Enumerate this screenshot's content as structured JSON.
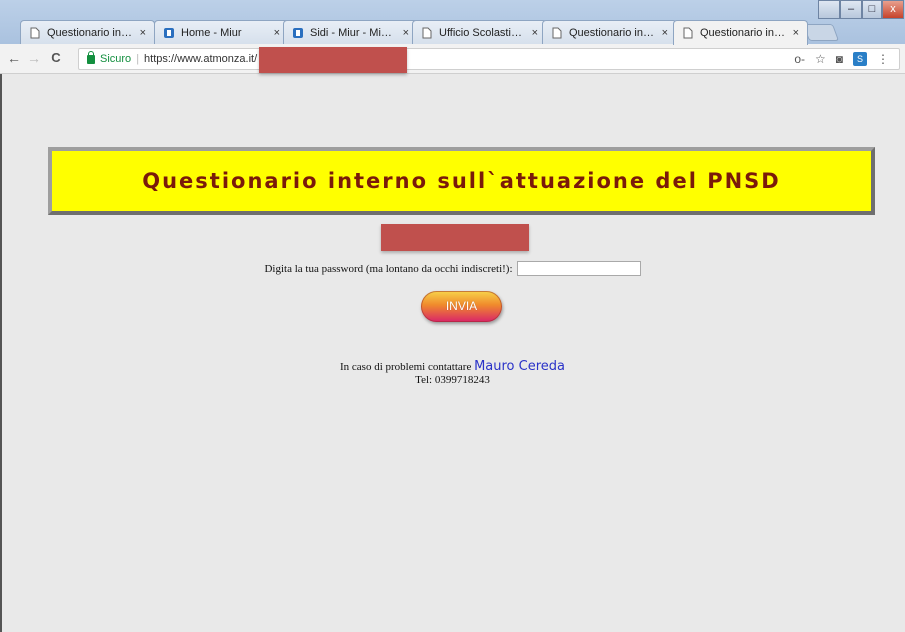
{
  "browser": {
    "tabs": [
      {
        "title": "Questionario interno s",
        "icon": "page-icon",
        "active": false
      },
      {
        "title": "Home - Miur",
        "icon": "miur-icon",
        "active": false
      },
      {
        "title": "Sidi - Miur - Ministero",
        "icon": "miur-icon",
        "active": false
      },
      {
        "title": "Ufficio Scolastico Terri",
        "icon": "page-icon",
        "active": false
      },
      {
        "title": "Questionario interno s",
        "icon": "page-icon",
        "active": false
      },
      {
        "title": "Questionario interno s",
        "icon": "page-icon",
        "active": true
      }
    ],
    "tab_close": "×",
    "window_controls": {
      "minimize": "–",
      "maximize": "□",
      "close": "x"
    },
    "nav": {
      "back": "←",
      "forward": "→",
      "reload": "C"
    },
    "address": {
      "secure_label": "Sicuro",
      "separator": "|",
      "url": "https://www.atmonza.it/"
    },
    "omni_icons": {
      "key": "o-",
      "star": "☆",
      "camera": "◙",
      "extension": "S"
    }
  },
  "page": {
    "title": "Questionario interno sull`attuazione del PNSD",
    "password_label": "Digita la tua password (ma lontano da occhi indiscreti!):",
    "password_value": "",
    "submit_label": "INVIA",
    "contact_prefix": "In caso di problemi contattare",
    "contact_name": "Mauro Cereda",
    "contact_phone": "Tel: 0399718243"
  },
  "colors": {
    "banner_bg": "#ffff00",
    "banner_text": "#7a1a0a",
    "redaction": "#c0504d",
    "link": "#2a32c8",
    "page_bg": "#e9e9e9"
  }
}
